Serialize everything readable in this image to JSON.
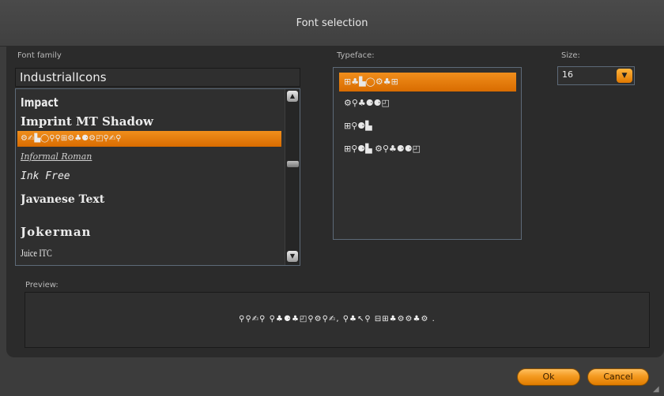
{
  "dialog": {
    "title": "Font selection"
  },
  "labels": {
    "font_family": "Font family",
    "typeface": "Typeface:",
    "size": "Size:",
    "preview": "Preview:"
  },
  "font_family_value": "IndustrialIcons",
  "font_list": [
    {
      "label": "Impact"
    },
    {
      "label": "Imprint MT Shadow"
    },
    {
      "label": "⚙✍▙◯⚲⚲⊞⚙♣⚈⚙◰⚲✍⚲",
      "selected": true
    },
    {
      "label": "Informal Roman"
    },
    {
      "label": "Ink Free"
    },
    {
      "label": "Javanese Text"
    },
    {
      "label": "Jokerman"
    },
    {
      "label": "Juice ITC"
    }
  ],
  "typefaces": [
    {
      "label": "⊞♣▙◯⚙♣⊞",
      "selected": true
    },
    {
      "label": "⚙⚲♣⚈⚈◰"
    },
    {
      "label": "⊞⚲⚈▙"
    },
    {
      "label": "⊞⚲⚈▙ ⚙⚲♣⚈⚈◰"
    }
  ],
  "size": {
    "value": "16"
  },
  "preview_text": "⚲⚲✍⚲ ⚲♣⚈♣◰⚲⚙⚲✍, ⚲♣↖⚲ ⊟⊞♣⚙⚙♣⚙ .",
  "buttons": {
    "ok": "Ok",
    "cancel": "Cancel"
  },
  "icons": {
    "scroll_up": "▲",
    "scroll_down": "▼",
    "dropdown": "▼",
    "resize_grip": "◢"
  },
  "colors": {
    "accent": "#f08e1c",
    "background": "#2b2b2b",
    "title_bar": "#444444"
  }
}
